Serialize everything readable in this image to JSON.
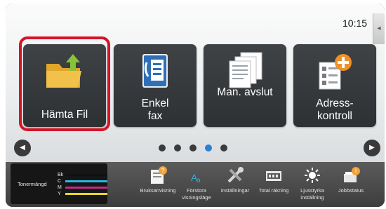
{
  "status": {
    "time": "10:15"
  },
  "home": {
    "tiles": [
      {
        "label": "Hämta Fil",
        "icon": "folder-upload-icon",
        "selected": true
      },
      {
        "label": "Enkel fax",
        "icon": "fax-address-book-icon",
        "selected": false
      },
      {
        "label": "Man. avslut",
        "icon": "document-stack-icon",
        "selected": false
      },
      {
        "label": "Adress-kontroll",
        "icon": "address-add-icon",
        "selected": false
      }
    ],
    "page_count": 5,
    "current_page": 4
  },
  "toner": {
    "title": "Tonermängd",
    "rows": [
      {
        "key": "Bk",
        "color": "#111111"
      },
      {
        "key": "C",
        "color": "#2bb6e0"
      },
      {
        "key": "M",
        "color": "#c02a8c"
      },
      {
        "key": "Y",
        "color": "#e8d52a"
      }
    ]
  },
  "taskbar": {
    "items": [
      {
        "label": "Bruksanvisning",
        "icon": "manual-icon"
      },
      {
        "label": "Förstora visningsläge",
        "icon": "zoom-display-icon"
      },
      {
        "label": "Inställningar",
        "icon": "settings-tools-icon"
      },
      {
        "label": "Total räkning",
        "icon": "counter-icon"
      },
      {
        "label": "Ljusstyrka inställning",
        "icon": "brightness-icon"
      },
      {
        "label": "Jobbstatus",
        "icon": "job-status-icon"
      }
    ]
  },
  "colors": {
    "accent_selected": "#d4142a",
    "page_dot_active": "#2a7fd6"
  }
}
